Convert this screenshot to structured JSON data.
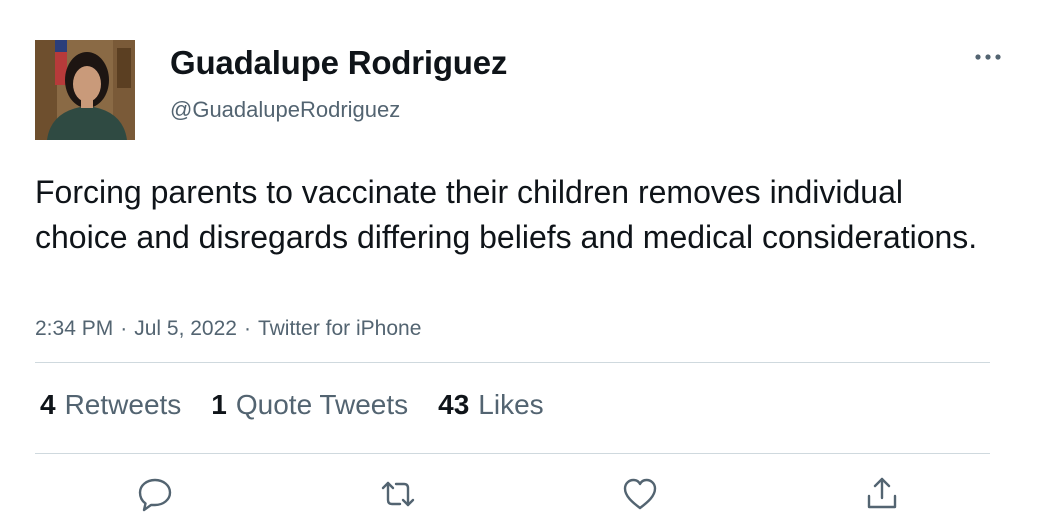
{
  "author": {
    "display_name": "Guadalupe Rodriguez",
    "handle": "@GuadalupeRodriguez"
  },
  "tweet": {
    "text": "Forcing parents to vaccinate their children removes individual choice and disregards differing beliefs and medical considerations.",
    "time": "2:34 PM",
    "date": "Jul 5, 2022",
    "separator": "·",
    "source": "Twitter for iPhone"
  },
  "stats": {
    "retweets_count": "4",
    "retweets_label": "Retweets",
    "quotes_count": "1",
    "quotes_label": "Quote Tweets",
    "likes_count": "43",
    "likes_label": "Likes"
  },
  "icons": {
    "more": "more-horizontal-icon",
    "reply": "reply-icon",
    "retweet": "retweet-icon",
    "like": "heart-icon",
    "share": "share-icon"
  },
  "colors": {
    "primary_text": "#0f1419",
    "secondary_text": "#536471",
    "divider": "#cfd9de"
  }
}
